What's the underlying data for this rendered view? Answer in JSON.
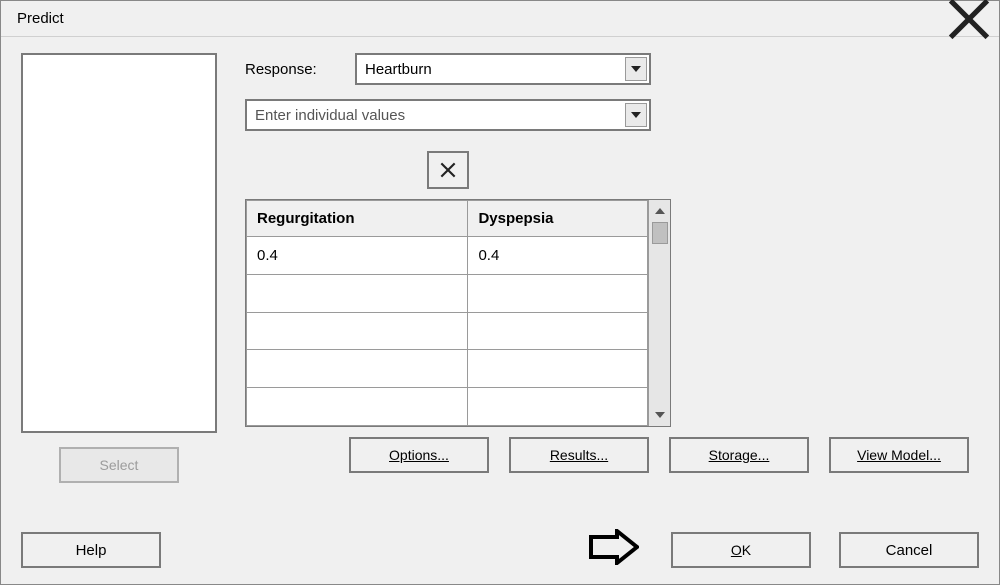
{
  "window": {
    "title": "Predict"
  },
  "labels": {
    "response": "Response:"
  },
  "controls": {
    "response_selected": "Heartburn",
    "values_placeholder": "Enter individual values",
    "remove_icon": "×"
  },
  "table": {
    "headers": [
      "Regurgitation",
      "Dyspepsia"
    ],
    "rows": [
      [
        "0.4",
        "0.4"
      ],
      [
        "",
        ""
      ],
      [
        "",
        ""
      ],
      [
        "",
        ""
      ],
      [
        "",
        ""
      ]
    ]
  },
  "buttons": {
    "select": "Select",
    "options": "Options...",
    "results": "Results...",
    "storage": "Storage...",
    "view_model": "View Model...",
    "help": "Help",
    "ok_u": "O",
    "ok_rest": "K",
    "cancel": "Cancel"
  }
}
